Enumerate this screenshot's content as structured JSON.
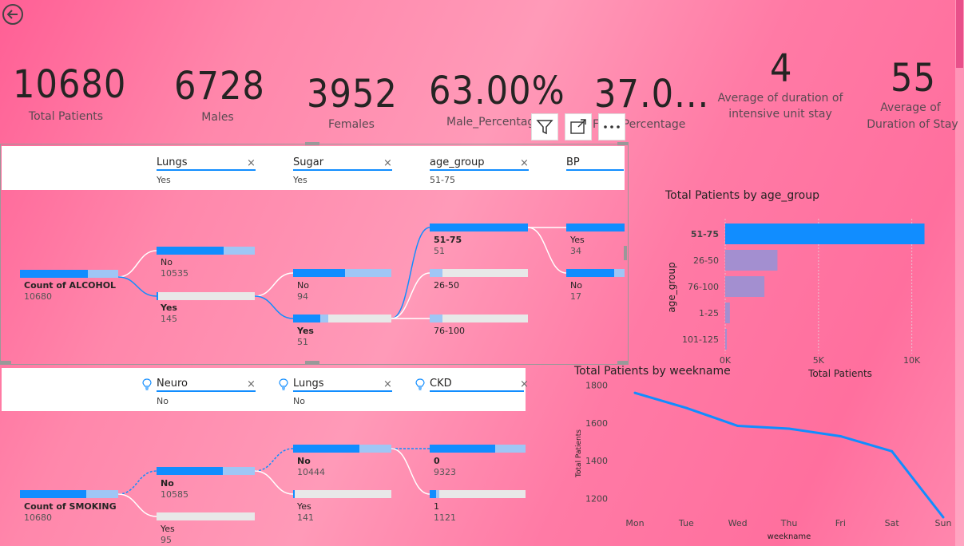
{
  "kpis": [
    {
      "value": "10680",
      "label": "Total Patients"
    },
    {
      "value": "6728",
      "label": "Males"
    },
    {
      "value": "3952",
      "label": "Females"
    },
    {
      "value": "63.00%",
      "label": "Male_Percentag"
    },
    {
      "value": "37.0...",
      "label": "F__e_Percentage"
    },
    {
      "value": "4",
      "label": "Average of duration of",
      "label2": "intensive unit stay"
    },
    {
      "value": "55",
      "label": "Average of",
      "label2": "Duration of Stay"
    }
  ],
  "tree1": {
    "filters": [
      {
        "name": "Lungs",
        "value": "Yes"
      },
      {
        "name": "Sugar",
        "value": "Yes"
      },
      {
        "name": "age_group",
        "value": "51-75"
      },
      {
        "name": "BP",
        "value": ""
      }
    ],
    "root": {
      "label": "Count of ALCOHOL",
      "value": "10680"
    },
    "level1": [
      {
        "label": "No",
        "value": "10535"
      },
      {
        "label": "Yes",
        "value": "145"
      }
    ],
    "level2": [
      {
        "label": "No",
        "value": "94"
      },
      {
        "label": "Yes",
        "value": "51"
      }
    ],
    "level3": [
      {
        "label": "51-75",
        "value": "51"
      },
      {
        "label": "26-50",
        "value": ""
      },
      {
        "label": "76-100",
        "value": ""
      }
    ],
    "level4": [
      {
        "label": "Yes",
        "value": "34"
      },
      {
        "label": "No",
        "value": "17"
      }
    ]
  },
  "tree2": {
    "filters": [
      {
        "name": "Neuro",
        "value": "No"
      },
      {
        "name": "Lungs",
        "value": "No"
      },
      {
        "name": "CKD",
        "value": ""
      }
    ],
    "root": {
      "label": "Count of SMOKING",
      "value": "10680"
    },
    "level1": [
      {
        "label": "No",
        "value": "10585"
      },
      {
        "label": "Yes",
        "value": "95"
      }
    ],
    "level2": [
      {
        "label": "No",
        "value": "10444"
      },
      {
        "label": "Yes",
        "value": "141"
      }
    ],
    "level3": [
      {
        "label": "0",
        "value": "9323"
      },
      {
        "label": "1",
        "value": "1121"
      }
    ]
  },
  "toolbar": {
    "icons": [
      "filter-icon",
      "focus-mode-icon",
      "more-options-icon"
    ]
  },
  "chart_data": [
    {
      "type": "bar",
      "title": "Total Patients by age_group",
      "xlabel": "Total Patients",
      "ylabel": "age_group",
      "categories": [
        "51-75",
        "26-50",
        "76-100",
        "1-25",
        "101-125"
      ],
      "values": [
        10680,
        2800,
        2100,
        250,
        60
      ],
      "xlim": [
        0,
        11000
      ],
      "xticks": [
        "0K",
        "5K",
        "10K"
      ],
      "colors": {
        "highlight": "#118dff",
        "other": "#a38fd0"
      }
    },
    {
      "type": "line",
      "title": "Total Patients by weekname",
      "xlabel": "weekname",
      "ylabel": "Total Patients",
      "categories": [
        "Mon",
        "Tue",
        "Wed",
        "Thu",
        "Fri",
        "Sat",
        "Sun"
      ],
      "values": [
        1760,
        1680,
        1585,
        1570,
        1530,
        1450,
        1100
      ],
      "ylim": [
        1100,
        1820
      ],
      "yticks": [
        "1800",
        "1600",
        "1400",
        "1200"
      ],
      "color": "#118dff"
    }
  ]
}
